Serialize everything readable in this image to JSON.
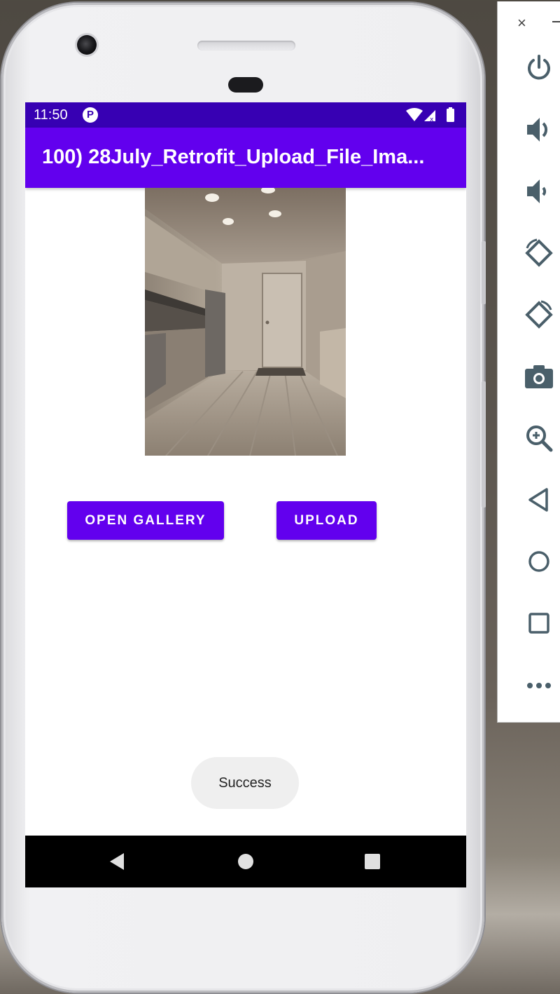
{
  "status_bar": {
    "time": "11:50",
    "app_icon_glyph": "P",
    "icons": [
      "wifi-icon",
      "signal-icon",
      "battery-icon"
    ]
  },
  "app_bar": {
    "title": "100) 28July_Retrofit_Upload_File_Ima..."
  },
  "preview": {
    "image": "kitchen-photo"
  },
  "buttons": {
    "open_gallery": "OPEN GALLERY",
    "upload": "UPLOAD"
  },
  "toast": {
    "message": "Success"
  },
  "nav_bar": {
    "icons": [
      "back-icon",
      "home-icon",
      "recents-icon"
    ]
  },
  "emulator_panel": {
    "icons": [
      "close-icon",
      "minimize-icon",
      "power-icon",
      "volume-up-icon",
      "volume-down-icon",
      "rotate-left-icon",
      "rotate-right-icon",
      "camera-icon",
      "zoom-icon",
      "back-icon",
      "home-icon",
      "overview-icon",
      "more-icon"
    ]
  },
  "colors": {
    "status_bar": "#3700b3",
    "primary": "#6200ee",
    "toast_bg": "#efefef",
    "nav_bar": "#000000"
  }
}
